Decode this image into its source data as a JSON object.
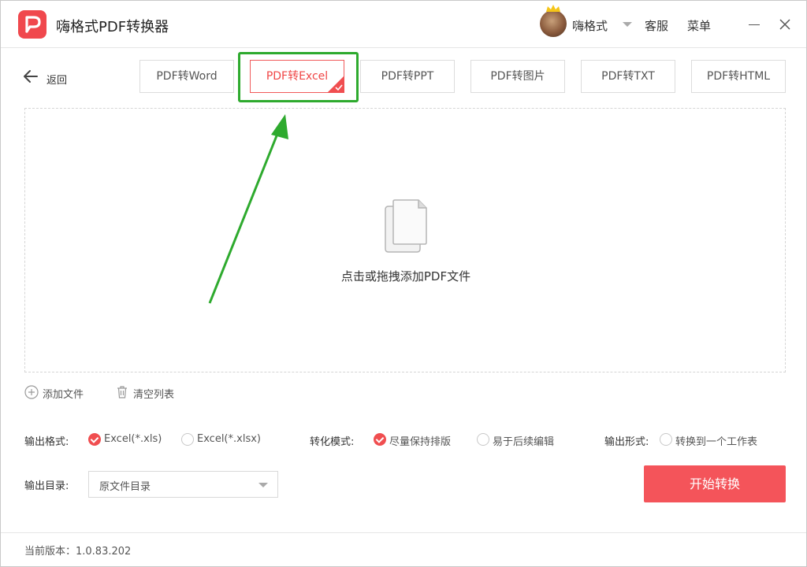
{
  "app": {
    "title": "嗨格式PDF转换器"
  },
  "user": {
    "name": "嗨格式"
  },
  "header": {
    "service": "客服",
    "menu": "菜单"
  },
  "nav": {
    "back": "返回"
  },
  "tabs": [
    {
      "label": "PDF转Word",
      "active": false
    },
    {
      "label": "PDF转Excel",
      "active": true
    },
    {
      "label": "PDF转PPT",
      "active": false
    },
    {
      "label": "PDF转图片",
      "active": false
    },
    {
      "label": "PDF转TXT",
      "active": false
    },
    {
      "label": "PDF转HTML",
      "active": false
    }
  ],
  "dropzone": {
    "label": "点击或拖拽添加PDF文件"
  },
  "actions": {
    "add_file": "添加文件",
    "clear_list": "清空列表"
  },
  "options": {
    "format": {
      "label": "输出格式:",
      "choices": [
        "Excel(*.xls)",
        "Excel(*.xlsx)"
      ],
      "selected": "Excel(*.xls)"
    },
    "mode": {
      "label": "转化模式:",
      "choices": [
        "尽量保持排版",
        "易于后续编辑"
      ],
      "selected": "尽量保持排版"
    },
    "form": {
      "label": "输出形式:",
      "choices": [
        "转换到一个工作表"
      ]
    }
  },
  "output": {
    "label": "输出目录:",
    "value": "原文件目录"
  },
  "start_button": "开始转换",
  "footer": {
    "version": "当前版本：1.0.83.202"
  },
  "colors": {
    "accent": "#f4545a",
    "highlight": "#2eaa2e"
  }
}
